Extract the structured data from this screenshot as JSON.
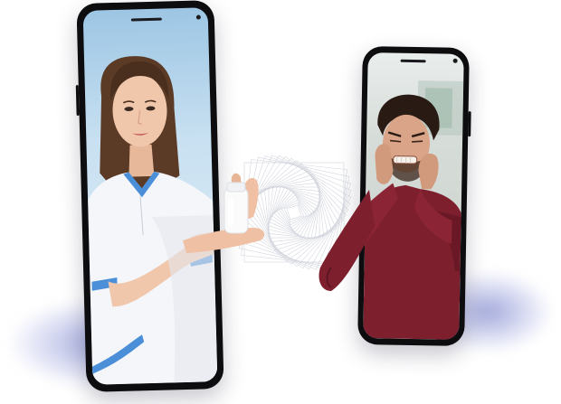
{
  "scene": {
    "description_tags": [
      "doctor-offering-pill-bottle",
      "man-with-toothache",
      "two-smartphones"
    ]
  },
  "colors": {
    "phone_body": "#0d0d10",
    "doctor_uniform": "#f4f6fa",
    "uniform_trim": "#4b8fd8",
    "man_sweater": "#7e1f2e",
    "shadow_blue": "#5a64be"
  }
}
